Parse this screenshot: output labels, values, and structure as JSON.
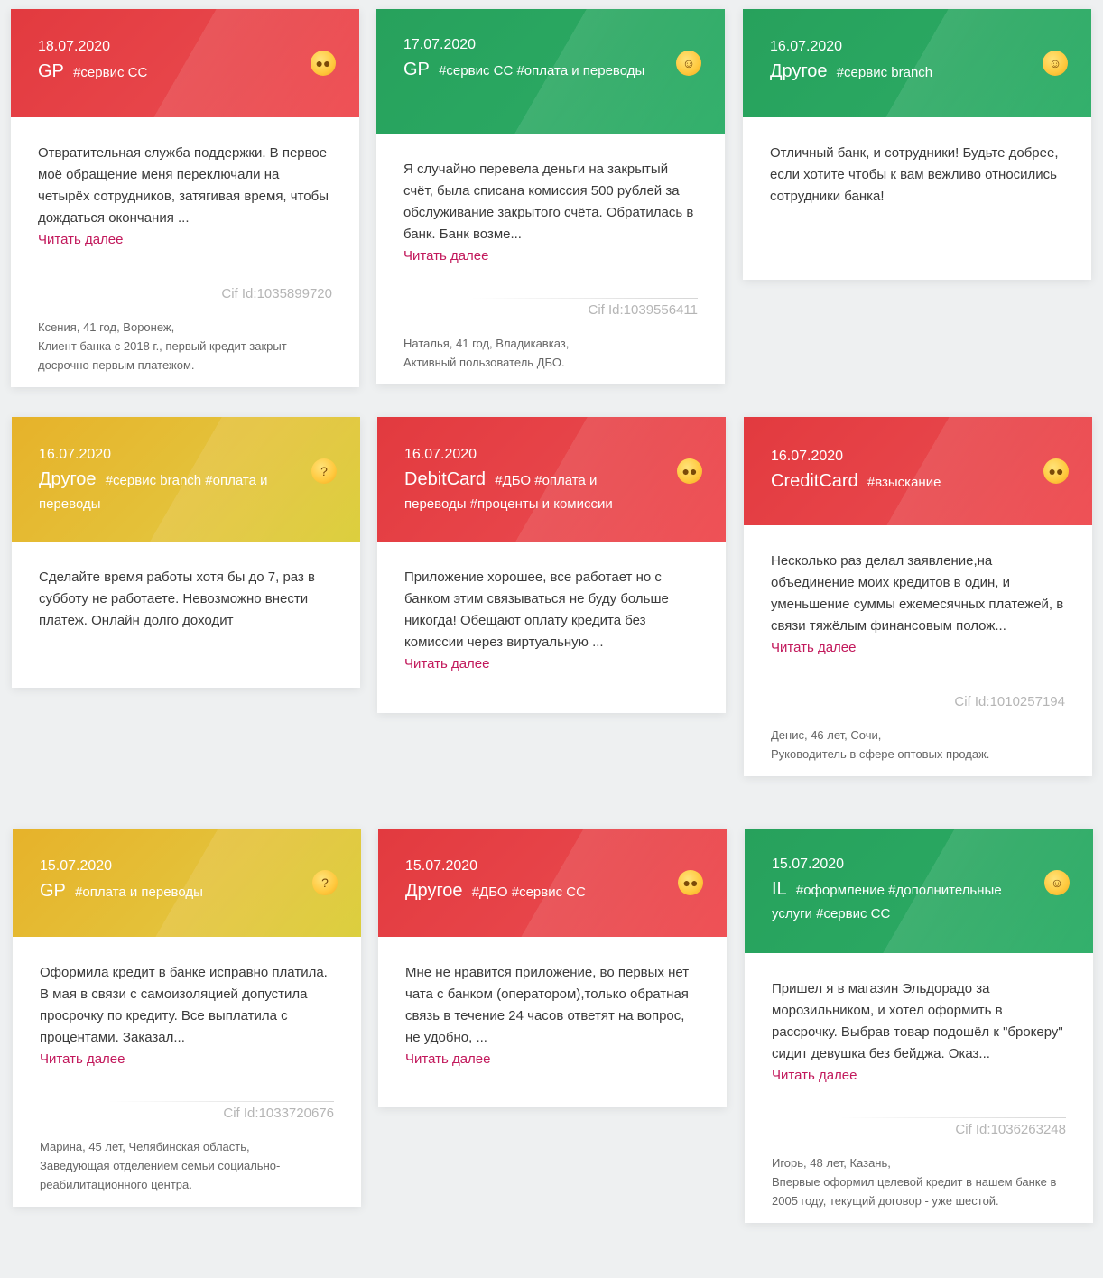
{
  "colors": {
    "red": "#e8464b",
    "green": "#2aa862",
    "yellow": "#e4c23a",
    "link": "#c2185b"
  },
  "read_more": "Читать далее",
  "cards": [
    {
      "date": "18.07.2020",
      "category": "GP",
      "tags": "#сервис CC",
      "sentiment": "angry-face-icon",
      "text": "Отвратительная служба поддержки. В первое моё обращение меня переключали на четырёх сотрудников, затягивая время, чтобы дождаться окончания ...",
      "cif": "Cif Id:1035899720",
      "author_line1": "Ксения, 41 год, Воронеж,",
      "author_line2": "Клиент банка с 2018 г., первый кредит закрыт досрочно первым платежом."
    },
    {
      "date": "17.07.2020",
      "category": "GP",
      "tags": "#сервис CC #оплата и переводы",
      "sentiment": "smiling-face-icon",
      "text": "Я случайно перевела деньги на закрытый счёт, была списана комиссия 500 рублей за обслуживание закрытого счёта. Обратилась в банк. Банк возме...",
      "cif": "Cif Id:1039556411",
      "author_line1": "Наталья, 41 год, Владикавказ,",
      "author_line2": "Активный пользователь ДБО."
    },
    {
      "date": "16.07.2020",
      "category": "Другое",
      "tags": "#сервис branch",
      "sentiment": "smiling-face-icon",
      "text": "Отличный банк, и сотрудники! Будьте добрее, если хотите чтобы к вам вежливо относились сотрудники банка!"
    },
    {
      "date": "16.07.2020",
      "category": "Другое",
      "tags": "#сервис branch #оплата и переводы",
      "sentiment": "thinking-face-icon",
      "text": "Сделайте время работы хотя бы до 7, раз в субботу не работаете. Невозможно внести платеж. Онлайн долго доходит"
    },
    {
      "date": "16.07.2020",
      "category": "DebitCard",
      "tags": "#ДБО #оплата и переводы #проценты и комиссии",
      "sentiment": "angry-face-icon",
      "text": "Приложение хорошее, все работает но с банком этим связываться не буду больше никогда! Обещают оплату кредита без комиссии через виртуальную ..."
    },
    {
      "date": "16.07.2020",
      "category": "CreditCard",
      "tags": "#взыскание",
      "sentiment": "angry-face-icon",
      "text": "Несколько раз делал заявление,на объединение моих кредитов в один, и уменьшение суммы ежемесячных платежей, в связи тяжёлым финансовым полож...",
      "cif": "Cif Id:1010257194",
      "author_line1": "Денис, 46 лет, Сочи,",
      "author_line2": "Руководитель в сфере оптовых продаж."
    },
    {
      "date": "15.07.2020",
      "category": "GP",
      "tags": "#оплата и переводы",
      "sentiment": "thinking-face-icon",
      "text": "Оформила кредит в банке исправно платила. В мая в связи с самоизоляцией допустила просрочку по кредиту. Все выплатила с процентами. Заказал...",
      "cif": "Cif Id:1033720676",
      "author_line1": "Марина, 45 лет, Челябинская область,",
      "author_line2": "Заведующая отделением семьи социально-реабилитационного центра."
    },
    {
      "date": "15.07.2020",
      "category": "Другое",
      "tags": "#ДБО #сервис CC",
      "sentiment": "angry-face-icon",
      "text": "Мне не нравится приложение, во первых нет чата с банком (оператором),только обратная связь в течение 24 часов ответят на вопрос, не удобно, ..."
    },
    {
      "date": "15.07.2020",
      "category": "IL",
      "tags": "#оформление #дополнительные услуги #сервис CC",
      "sentiment": "smiling-face-icon",
      "text": "Пришел я в магазин Эльдорадо за морозильником, и хотел оформить в рассрочку. Выбрав товар подошёл к \"брокеру\" сидит девушка без бейджа. Оказ...",
      "cif": "Cif Id:1036263248",
      "author_line1": "Игорь, 48 лет, Казань,",
      "author_line2": "Впервые оформил целевой кредит в нашем банке в 2005 году, текущий договор - уже шестой."
    }
  ]
}
